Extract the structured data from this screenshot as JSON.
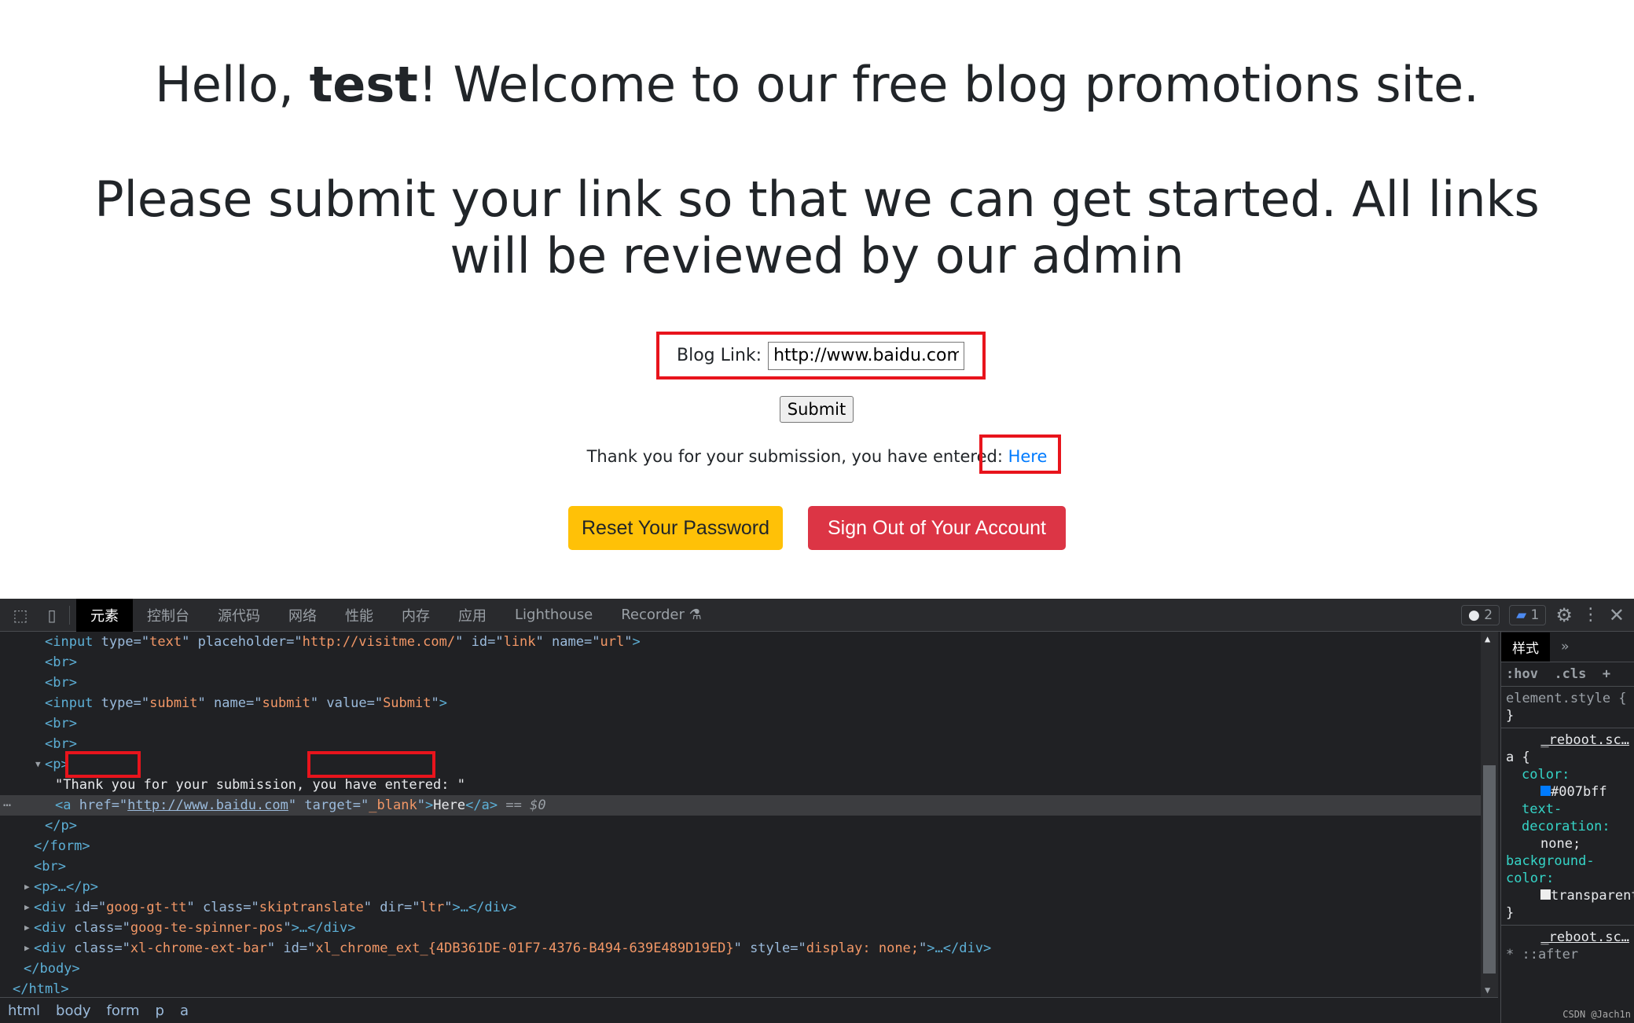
{
  "page": {
    "greeting_prefix": "Hello, ",
    "username": "test",
    "greeting_suffix": "! Welcome to our free blog promotions site.",
    "subheading": "Please submit your link so that we can get started. All links will be reviewed by our admin",
    "form": {
      "label": "Blog Link:",
      "value": "http://www.baidu.com",
      "submit": "Submit"
    },
    "thanks": "Thank you for your submission, you have entered: ",
    "link_text": "Here",
    "reset_button": "Reset Your Password",
    "signout_button": "Sign Out of Your Account",
    "colors": {
      "reset": "#ffc107",
      "signout": "#dc3545",
      "link": "#007bff",
      "highlight": "#e8141c"
    }
  },
  "devtools": {
    "tabs": [
      "元素",
      "控制台",
      "源代码",
      "网络",
      "性能",
      "内存",
      "应用",
      "Lighthouse",
      "Recorder"
    ],
    "issues_count": "2",
    "messages_count": "1",
    "code_lines": [
      "<input type=\"text\" placeholder=\"http://visitme.com/\" id=\"link\" name=\"url\">",
      "<br>",
      "<br>",
      "<input type=\"submit\" name=\"submit\" value=\"Submit\">",
      "<br>",
      "<br>",
      "<p>",
      "\"Thank you for your submission, you have entered: \"",
      "<a href=\"http://www.baidu.com\" target=\"_blank\">Here</a> == $0",
      "</p>",
      "</form>",
      "<br>",
      "<p>…</p>",
      "<div id=\"goog-gt-tt\" class=\"skiptranslate\" dir=\"ltr\">…</div>",
      "<div class=\"goog-te-spinner-pos\">…</div>",
      "<div class=\"xl-chrome-ext-bar\" id=\"xl_chrome_ext_{4DB361DE-01F7-4376-B494-639E489D19ED}\" style=\"display: none;\">…</div>",
      "</body>",
      "</html>"
    ],
    "breadcrumb": [
      "html",
      "body",
      "form",
      "p",
      "a"
    ],
    "styles": {
      "tab": "样式",
      "hov": ":hov",
      "cls": ".cls",
      "element_style": "element.style {",
      "close": "}",
      "source": "_reboot.sc…",
      "selector": "a {",
      "color_prop": "color:",
      "color_val": "#007bff",
      "td_prop": "text-decoration:",
      "td_val": "none;",
      "bg_prop": "background-color:",
      "bg_val": "transparent",
      "source2": "_reboot.sc…",
      "selector2": "* ::after"
    },
    "watermark": "CSDN @Jach1n"
  }
}
